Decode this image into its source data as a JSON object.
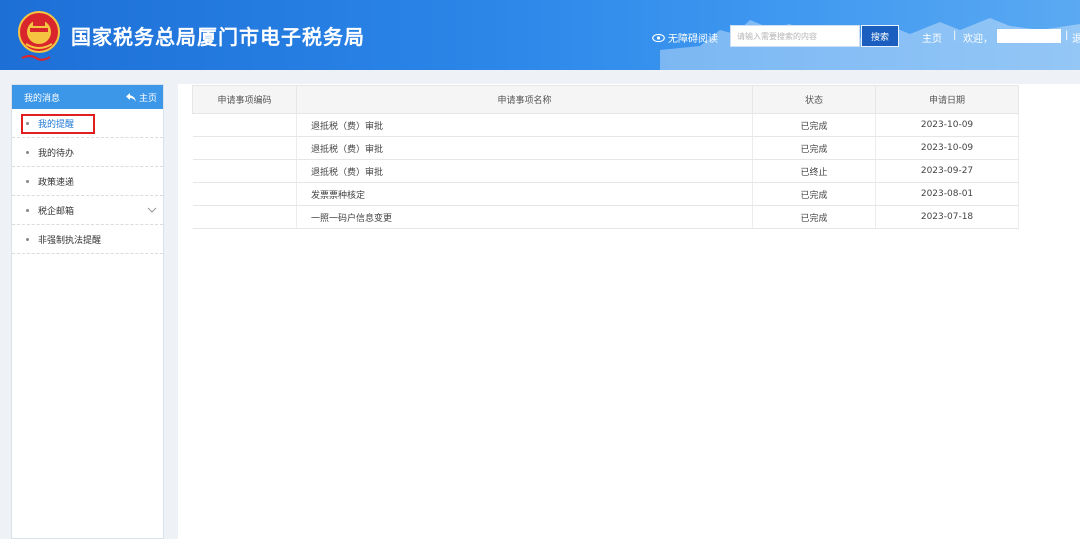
{
  "header": {
    "site_title": "国家税务总局厦门市电子税务局",
    "accessibility_label": "无障碍阅读",
    "search_placeholder": "请输入需要搜索的内容",
    "search_button": "搜索",
    "nav_home": "主页",
    "separator": "|",
    "welcome": "欢迎，",
    "exit_fragment": "退"
  },
  "sidebar": {
    "title": "我的消息",
    "home_link": "主页",
    "items": [
      {
        "label": "我的提醒",
        "active": true
      },
      {
        "label": "我的待办"
      },
      {
        "label": "政策速递"
      },
      {
        "label": "税企邮箱",
        "expandable": true
      },
      {
        "label": "非强制执法提醒"
      }
    ]
  },
  "table": {
    "columns": [
      "申请事项编码",
      "申请事项名称",
      "状态",
      "申请日期"
    ],
    "rows": [
      {
        "code": "",
        "name": "退抵税（费）审批",
        "status": "已完成",
        "date": "2023-10-09"
      },
      {
        "code": "",
        "name": "退抵税（费）审批",
        "status": "已完成",
        "date": "2023-10-09"
      },
      {
        "code": "",
        "name": "退抵税（费）审批",
        "status": "已终止",
        "date": "2023-09-27"
      },
      {
        "code": "",
        "name": "发票票种核定",
        "status": "已完成",
        "date": "2023-08-01"
      },
      {
        "code": "",
        "name": "一照一码户信息变更",
        "status": "已完成",
        "date": "2023-07-18"
      }
    ]
  },
  "colors": {
    "header_blue": "#2b86e8",
    "sidebar_head": "#3d97e8",
    "active_link": "#1e78d6",
    "highlight_box": "#e02020"
  }
}
